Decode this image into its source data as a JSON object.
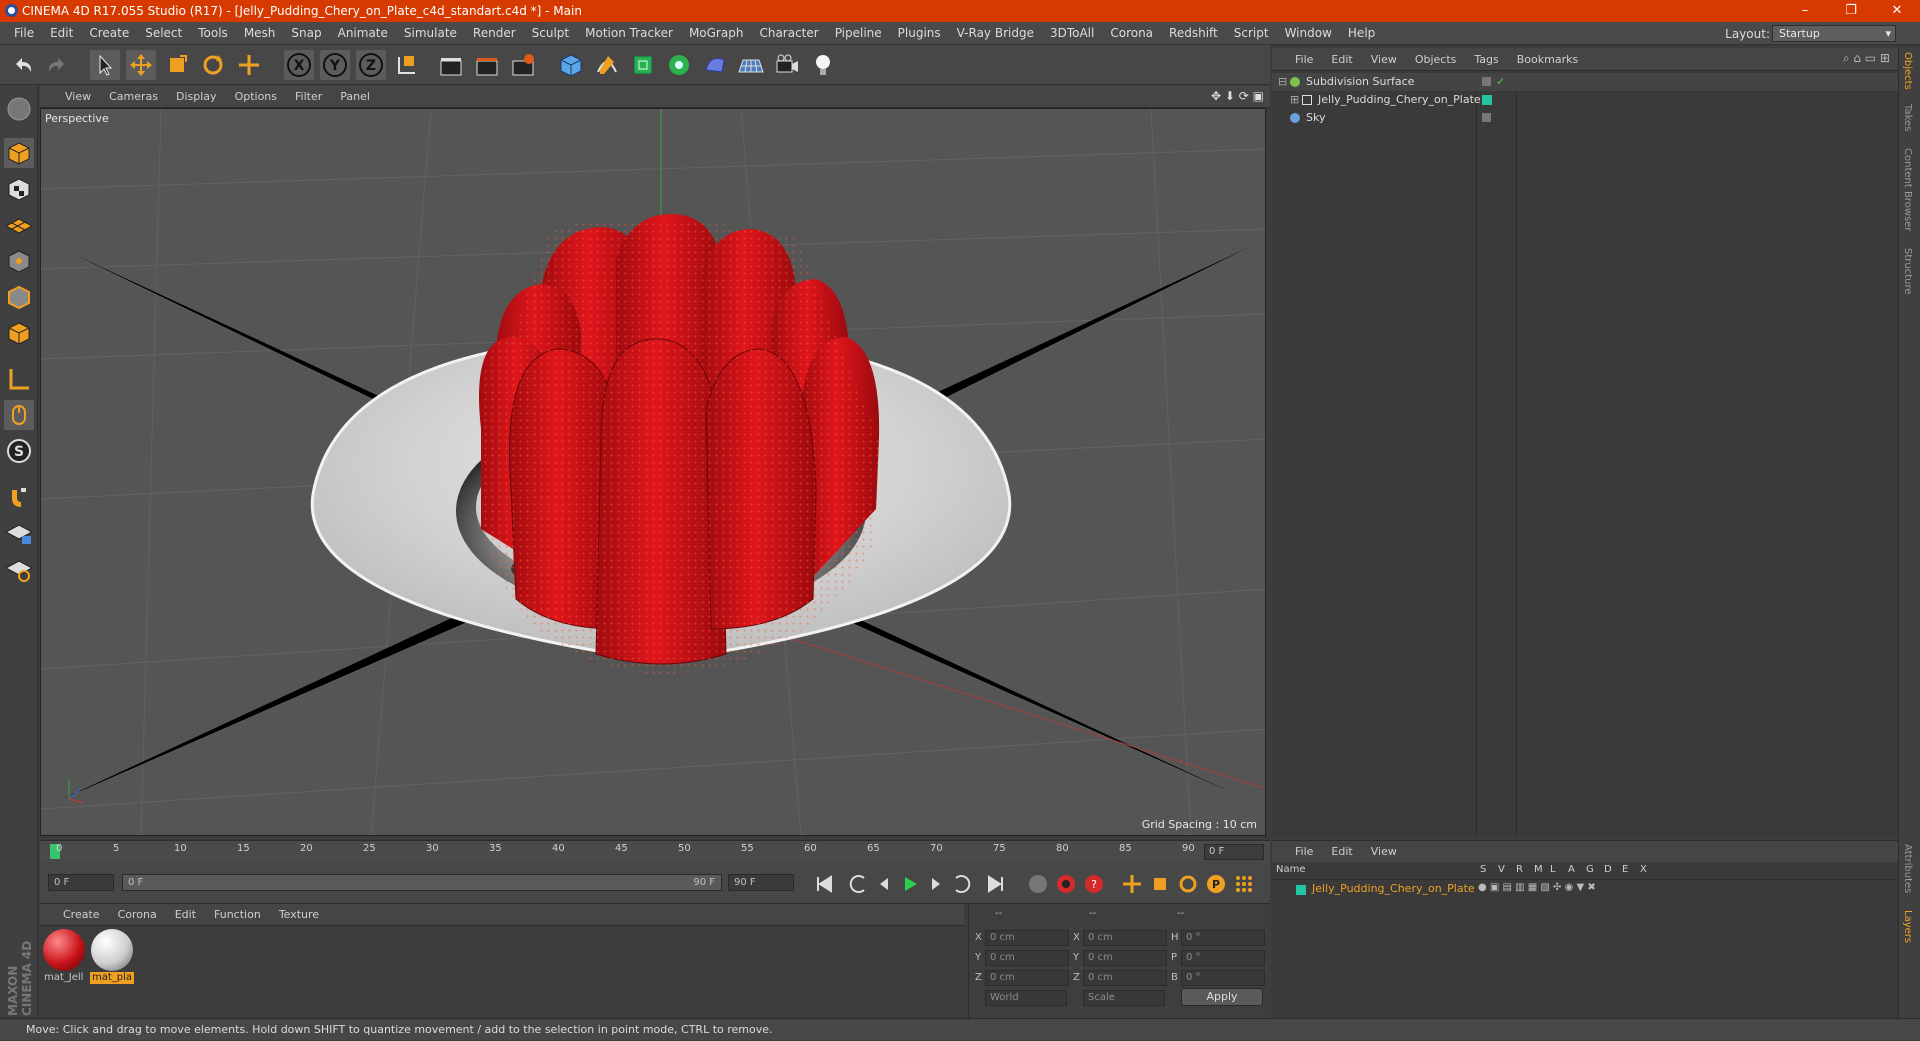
{
  "window": {
    "title": "CINEMA 4D R17.055 Studio (R17) - [Jelly_Pudding_Chery_on_Plate_c4d_standart.c4d *] - Main",
    "controls": [
      "–",
      "❐",
      "✕"
    ]
  },
  "menu": [
    "File",
    "Edit",
    "Create",
    "Select",
    "Tools",
    "Mesh",
    "Snap",
    "Animate",
    "Simulate",
    "Render",
    "Sculpt",
    "Motion Tracker",
    "MoGraph",
    "Character",
    "Pipeline",
    "Plugins",
    "V-Ray Bridge",
    "3DToAll",
    "Corona",
    "Redshift",
    "Script",
    "Window",
    "Help"
  ],
  "layout": {
    "label": "Layout:",
    "value": "Startup"
  },
  "viewport": {
    "menu": [
      "View",
      "Cameras",
      "Display",
      "Options",
      "Filter",
      "Panel"
    ],
    "label": "Perspective",
    "grid_spacing": "Grid Spacing : 10 cm"
  },
  "timeline": {
    "ticks": [
      "0",
      "5",
      "10",
      "15",
      "20",
      "25",
      "30",
      "35",
      "40",
      "45",
      "50",
      "55",
      "60",
      "65",
      "70",
      "75",
      "80",
      "85",
      "90"
    ],
    "current_frame": "0 F",
    "start_field": "0 F",
    "range_start": "0 F",
    "range_end": "90 F",
    "end_field": "90 F"
  },
  "materials": {
    "menu": [
      "Create",
      "Corona",
      "Edit",
      "Function",
      "Texture"
    ],
    "items": [
      {
        "label": "mat_Jell",
        "color": "#c8141a"
      },
      {
        "label": "mat_pla",
        "color": "#d9d9d9"
      }
    ]
  },
  "coordinates": {
    "headers": [
      "--",
      "--",
      "--"
    ],
    "rows": [
      {
        "a": "X",
        "av": "0 cm",
        "b": "X",
        "bv": "0 cm",
        "c": "H",
        "cv": "0 °"
      },
      {
        "a": "Y",
        "av": "0 cm",
        "b": "Y",
        "bv": "0 cm",
        "c": "P",
        "cv": "0 °"
      },
      {
        "a": "Z",
        "av": "0 cm",
        "b": "Z",
        "bv": "0 cm",
        "c": "B",
        "cv": "0 °"
      }
    ],
    "mode1": "World",
    "mode2": "Scale",
    "apply": "Apply"
  },
  "objects": {
    "menu": [
      "File",
      "Edit",
      "View",
      "Objects",
      "Tags",
      "Bookmarks"
    ],
    "items": [
      {
        "name": "Subdivision Surface",
        "color": "#7cc24a"
      },
      {
        "name": "Jelly_Pudding_Chery_on_Plate",
        "color": "#22c6a0"
      },
      {
        "name": "Sky",
        "color": "#6aa0d8"
      }
    ]
  },
  "layers": {
    "menu": [
      "File",
      "Edit",
      "View"
    ],
    "columns": [
      "Name",
      "S",
      "V",
      "R",
      "M",
      "L",
      "A",
      "G",
      "D",
      "E",
      "X"
    ],
    "row": "Jelly_Pudding_Chery_on_Plate"
  },
  "side_tabs": [
    "Objects",
    "Takes",
    "Content Browser",
    "Structure",
    "Attributes",
    "Layers"
  ],
  "brand": "MAXON CINEMA 4D",
  "status": "Move: Click and drag to move elements. Hold down SHIFT to quantize movement / add to the selection in point mode, CTRL to remove.",
  "colors": {
    "accent": "#d73a00",
    "jelly": "#c8141a",
    "selection": "#f0a020"
  }
}
